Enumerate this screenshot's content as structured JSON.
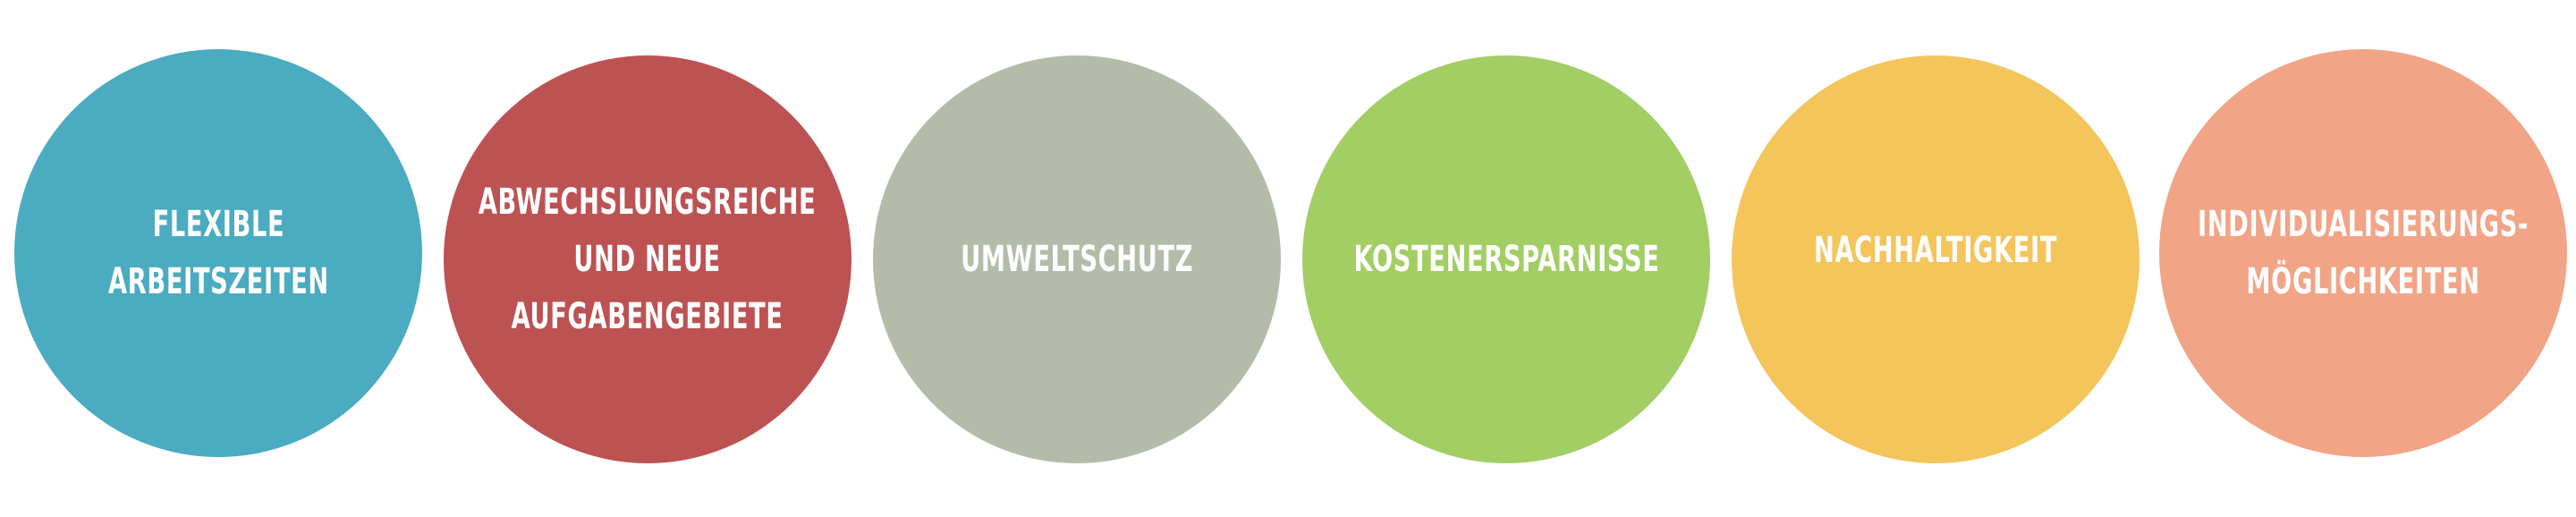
{
  "circles": [
    {
      "lines": [
        "FLEXIBLE",
        "ARBEITSZEITEN"
      ],
      "color": "#4BABC0"
    },
    {
      "lines": [
        "ABWECHSLUNGSREICHE",
        "UND NEUE",
        "AUFGABENGEBIETE"
      ],
      "color": "#BD5253"
    },
    {
      "lines": [
        "UMWELTSCHUTZ"
      ],
      "color": "#B4BCA9"
    },
    {
      "lines": [
        "KOSTENERSPARNISSE"
      ],
      "color": "#A2CE64"
    },
    {
      "lines": [
        "NACHHALTIGKEIT"
      ],
      "color": "#F4C55B"
    },
    {
      "lines": [
        "INDIVIDUALISIERUNGS-",
        "MÖGLICHKEITEN"
      ],
      "color": "#F2A487"
    }
  ]
}
